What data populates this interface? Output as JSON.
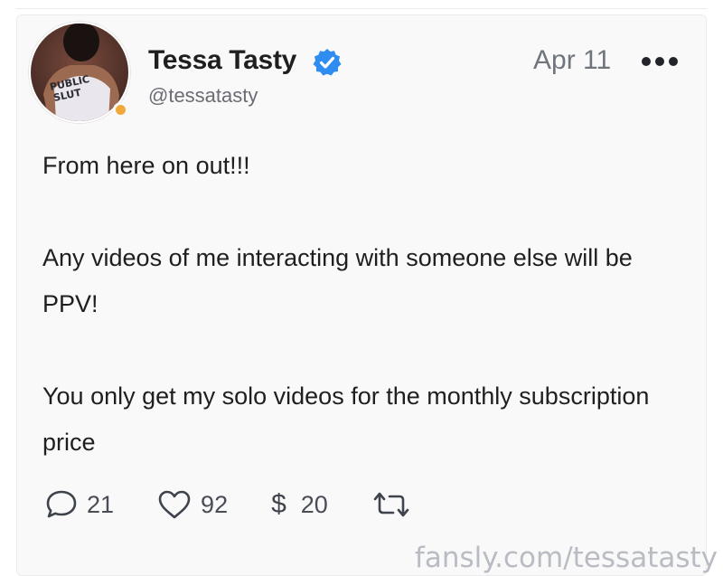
{
  "post": {
    "author": {
      "display_name": "Tessa Tasty",
      "handle": "@tessatasty",
      "verified": true,
      "online_status_color": "#f2a93b",
      "avatar_shirt_text": [
        "PUBLIC",
        "SLUT"
      ]
    },
    "date": "Apr 11",
    "more_icon": "more-dots-icon",
    "body": [
      "From here on out!!!",
      "",
      "Any videos of me interacting with someone else will be PPV!",
      "",
      "You only get my solo videos for the monthly subscription price"
    ],
    "stats": {
      "comments": "21",
      "likes": "92",
      "tips_symbol": "$",
      "tips": "20"
    }
  },
  "watermark": "fansly.com/tessatasty",
  "colors": {
    "verified_badge": "#2f8cf0",
    "card_background": "#f9f9fa"
  }
}
